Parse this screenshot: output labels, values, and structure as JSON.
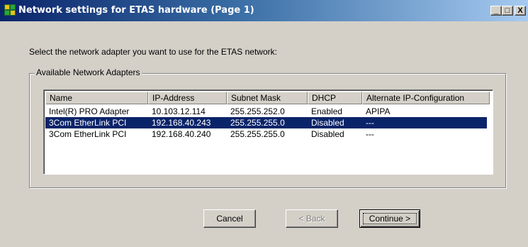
{
  "window": {
    "title": "Network settings for ETAS hardware (Page 1)",
    "icon": "network-app-icon",
    "controls": {
      "minimize": "_",
      "maximize": "□",
      "close": "X"
    }
  },
  "prompt": "Select the network adapter you want to use for the ETAS network:",
  "group_label": "Available Network Adapters",
  "table": {
    "columns": [
      "Name",
      "IP-Address",
      "Subnet Mask",
      "DHCP",
      "Alternate IP-Configuration"
    ],
    "rows": [
      {
        "name": "Intel(R) PRO Adapter",
        "ip": "10.103.12.114",
        "mask": "255.255.252.0",
        "dhcp": "Enabled",
        "alt": "APIPA",
        "selected": false
      },
      {
        "name": "3Com EtherLink PCI",
        "ip": "192.168.40.243",
        "mask": "255.255.255.0",
        "dhcp": "Disabled",
        "alt": "---",
        "selected": true
      },
      {
        "name": "3Com EtherLink PCI",
        "ip": "192.168.40.240",
        "mask": "255.255.255.0",
        "dhcp": "Disabled",
        "alt": "---",
        "selected": false
      }
    ]
  },
  "buttons": {
    "cancel": "Cancel",
    "back": "< Back",
    "continue": "Continue >"
  },
  "colors": {
    "title_bar_start": "#0a246a",
    "title_bar_end": "#a6caf0",
    "selection": "#0a246a",
    "dialog_face": "#d4d0c8"
  }
}
